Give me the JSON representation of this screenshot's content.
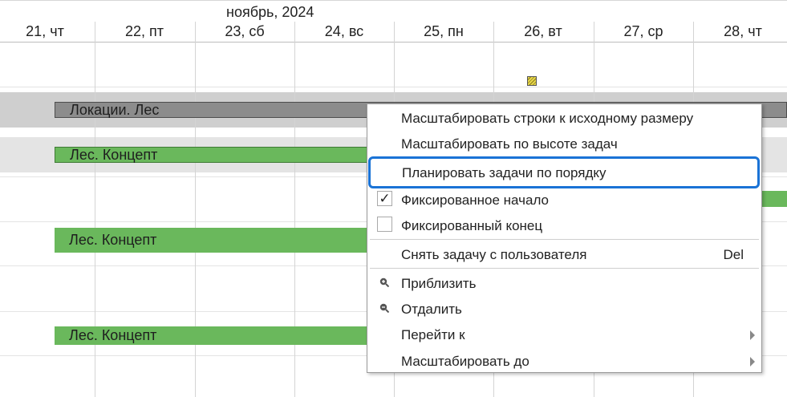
{
  "timeline": {
    "month": "ноябрь, 2024",
    "days": [
      "21, чт",
      "22, пт",
      "23, сб",
      "24, вс",
      "25, пн",
      "26, вт",
      "27, ср",
      "28, чт"
    ]
  },
  "bars": {
    "group": "Локации. Лес",
    "task1": "Лес. Концепт",
    "task2": "Лес. Концепт",
    "task3": "Лес. Концепт"
  },
  "context_menu": {
    "scale_rows_original": "Масштабировать строки к исходному размеру",
    "scale_task_height": "Масштабировать по высоте задач",
    "plan_tasks_order": "Планировать задачи по порядку",
    "fixed_start": "Фиксированное начало",
    "fixed_start_checked": "✓",
    "fixed_end": "Фиксированный конец",
    "unassign_task": "Снять задачу с пользователя",
    "unassign_shortcut": "Del",
    "zoom_in": "Приблизить",
    "zoom_out": "Отдалить",
    "go_to": "Перейти к",
    "scale_to": "Масштабировать до"
  },
  "colors": {
    "highlight_border": "#1a73d6",
    "task_green": "#6ab85c",
    "group_gray": "#8c8c8c"
  }
}
